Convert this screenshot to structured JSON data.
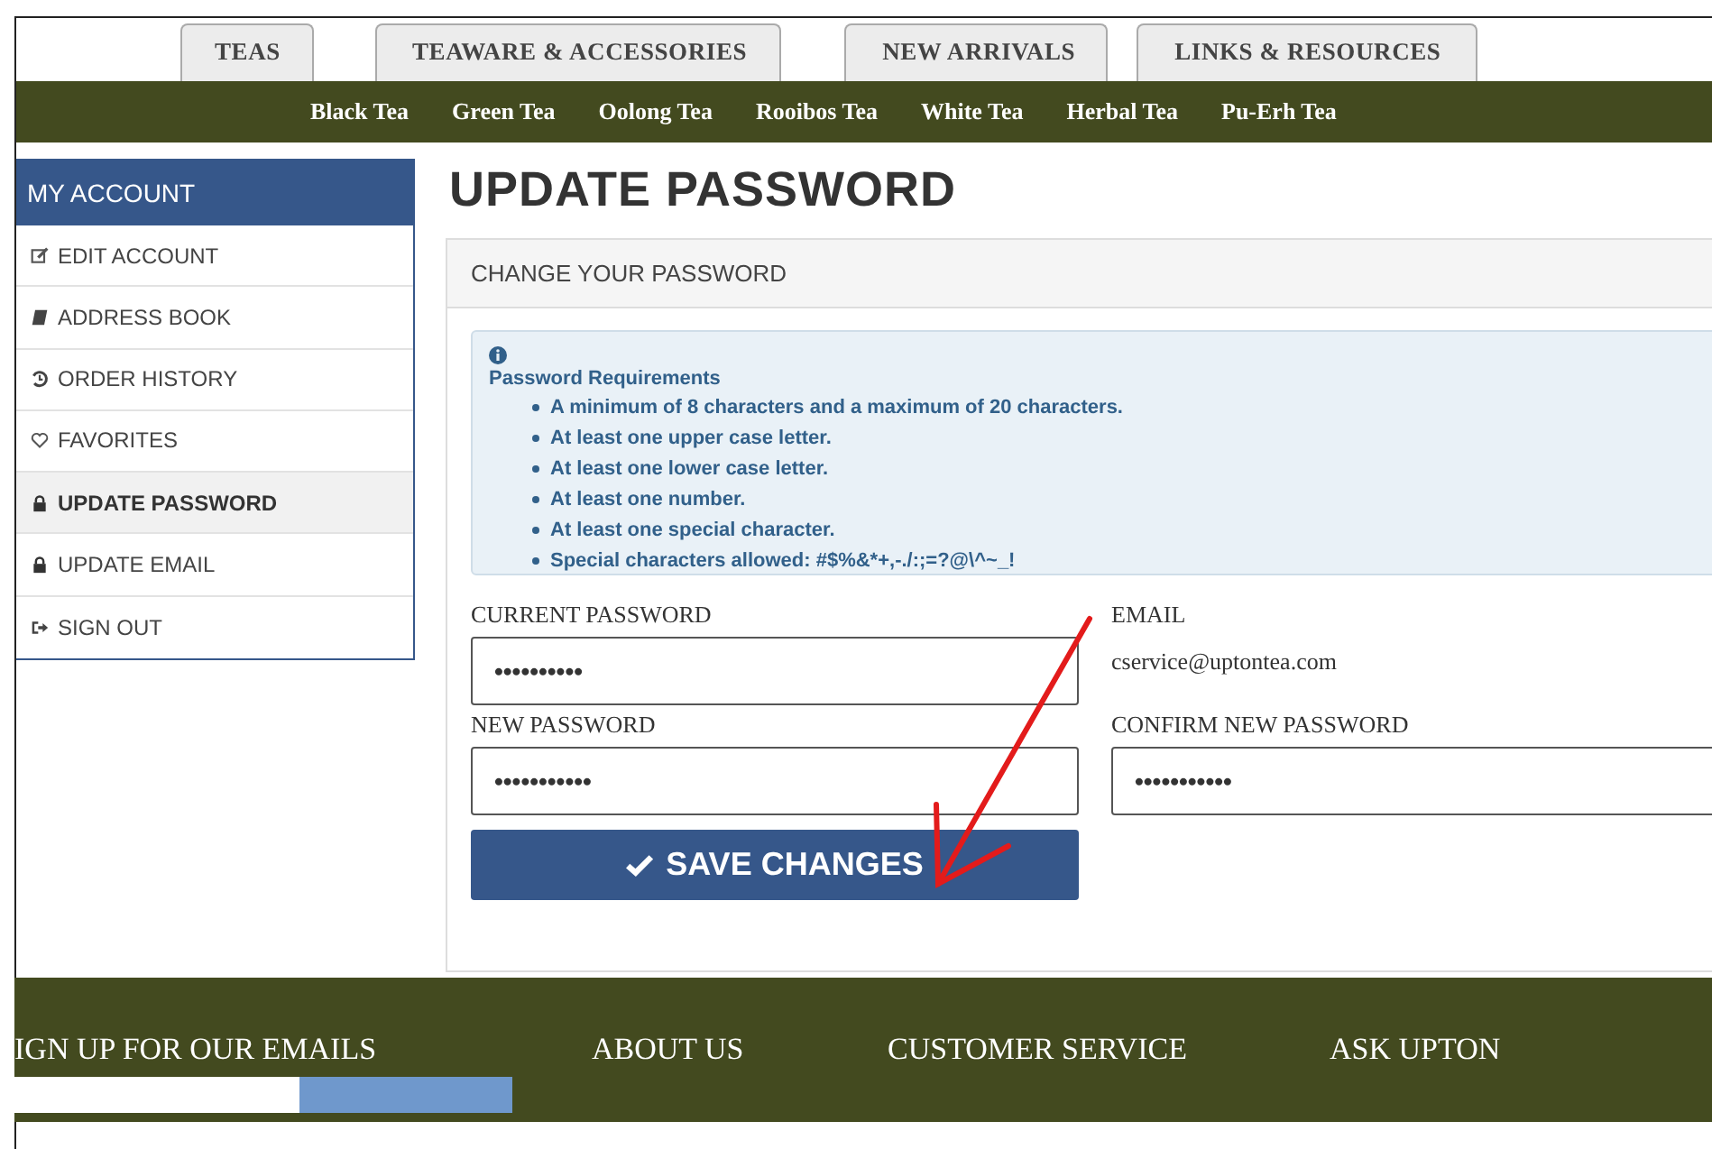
{
  "tabs": [
    {
      "label": "TEAS"
    },
    {
      "label": "TEAWARE & ACCESSORIES"
    },
    {
      "label": "NEW ARRIVALS"
    },
    {
      "label": "LINKS & RESOURCES"
    }
  ],
  "nav": [
    "Black Tea",
    "Green Tea",
    "Oolong Tea",
    "Rooibos Tea",
    "White Tea",
    "Herbal Tea",
    "Pu-Erh Tea"
  ],
  "sidebar": {
    "title": "MY ACCOUNT",
    "items": [
      {
        "label": "EDIT ACCOUNT",
        "kind": "edit",
        "selected": false
      },
      {
        "label": "ADDRESS BOOK",
        "kind": "book",
        "selected": false
      },
      {
        "label": "ORDER HISTORY",
        "kind": "history",
        "selected": false
      },
      {
        "label": "FAVORITES",
        "kind": "heart",
        "selected": false
      },
      {
        "label": "UPDATE PASSWORD",
        "kind": "lock",
        "selected": true
      },
      {
        "label": "UPDATE EMAIL",
        "kind": "lock",
        "selected": false
      },
      {
        "label": "SIGN OUT",
        "kind": "signout",
        "selected": false
      }
    ]
  },
  "heading": "UPDATE PASSWORD",
  "panel": {
    "title": "CHANGE YOUR PASSWORD",
    "alert": {
      "title": "Password Requirements",
      "items": [
        "A minimum of 8 characters and a maximum of 20 characters.",
        "At least one upper case letter.",
        "At least one lower case letter.",
        "At least one number.",
        "At least one special character.",
        "Special characters allowed: #$%&*+,-./:;=?@\\^~_!"
      ]
    },
    "current_password": {
      "label": "CURRENT PASSWORD",
      "value": "••••••••••"
    },
    "email": {
      "label": "EMAIL",
      "value": "cservice@uptontea.com"
    },
    "new_password": {
      "label": "NEW PASSWORD",
      "value": "•••••••••••"
    },
    "confirm_password": {
      "label": "CONFIRM NEW PASSWORD",
      "value": "•••••••••••"
    },
    "save_button": "SAVE CHANGES"
  },
  "footer": {
    "headings": [
      "IGN UP FOR OUR EMAILS",
      "ABOUT US",
      "CUSTOMER SERVICE",
      "ASK UPTON"
    ]
  }
}
